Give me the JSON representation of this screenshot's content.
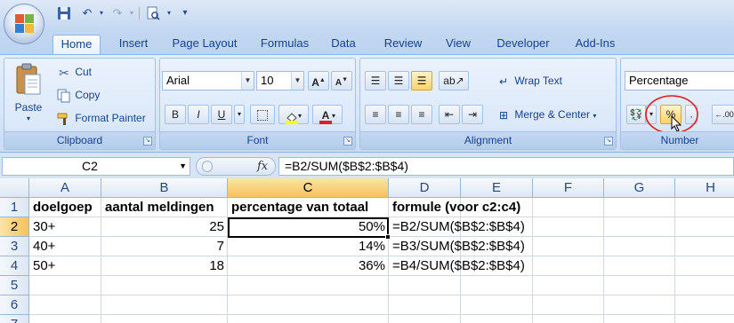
{
  "qat": {
    "undo_icon": "undo-icon",
    "redo_icon": "redo-icon",
    "save_icon": "save-icon",
    "preview_icon": "print-preview-icon"
  },
  "tabs": [
    {
      "label": "Home",
      "active": true
    },
    {
      "label": "Insert"
    },
    {
      "label": "Page Layout"
    },
    {
      "label": "Formulas"
    },
    {
      "label": "Data"
    },
    {
      "label": "Review"
    },
    {
      "label": "View"
    },
    {
      "label": "Developer"
    },
    {
      "label": "Add-Ins"
    }
  ],
  "clipboard": {
    "paste": "Paste",
    "cut": "Cut",
    "copy": "Copy",
    "format_painter": "Format Painter",
    "label": "Clipboard"
  },
  "font": {
    "name": "Arial",
    "size": "10",
    "bold": "B",
    "italic": "I",
    "underline": "U",
    "label": "Font"
  },
  "alignment": {
    "wrap_text": "Wrap Text",
    "merge_center": "Merge & Center",
    "label": "Alignment"
  },
  "number": {
    "format": "Percentage",
    "percent": "%",
    "label": "Number"
  },
  "formula_bar": {
    "name_box": "C2",
    "fx": "fx",
    "formula": "=B2/SUM($B$2:$B$4)"
  },
  "columns": [
    "A",
    "B",
    "C",
    "D",
    "E",
    "F",
    "G",
    "H"
  ],
  "rows": [
    "1",
    "2",
    "3",
    "4",
    "5",
    "6",
    "7"
  ],
  "cells": {
    "A1": "doelgoep",
    "B1": "aantal meldingen",
    "C1": "percentage van totaal",
    "D1": "formule (voor c2:c4)",
    "A2": "30+",
    "B2": "25",
    "C2": "50%",
    "D2": "=B2/SUM($B$2:$B$4)",
    "A3": "40+",
    "B3": "7",
    "C3": "14%",
    "D3": "=B3/SUM($B$2:$B$4)",
    "A4": "50+",
    "B4": "18",
    "C4": "36%",
    "D4": "=B4/SUM($B$2:$B$4)"
  },
  "colors": {
    "accent": "#15428b",
    "selection": "#f6c25c",
    "highlight_circle": "#e02020"
  }
}
